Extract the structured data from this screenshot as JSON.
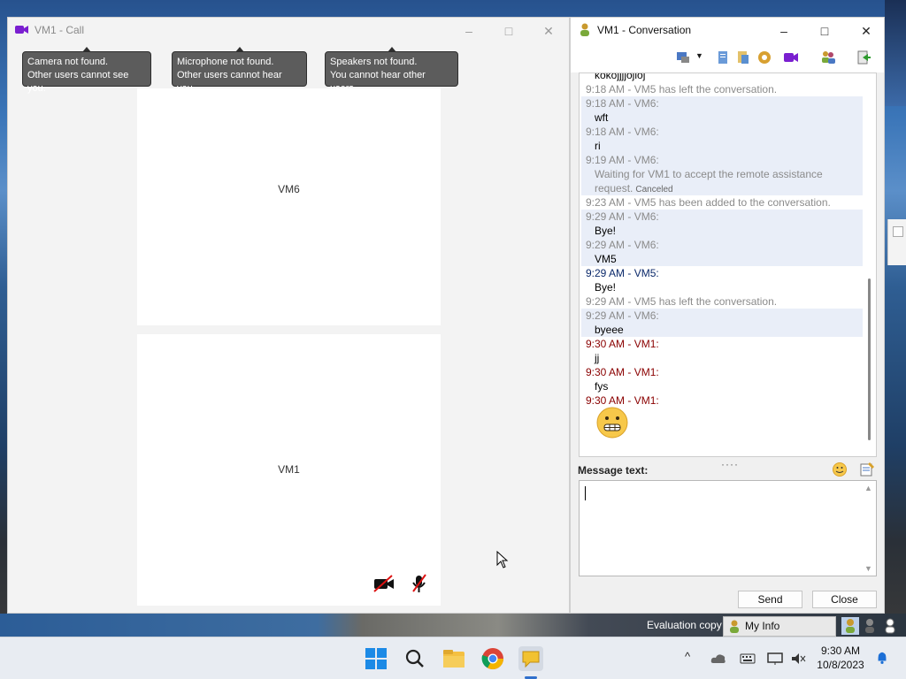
{
  "call_window": {
    "title": "VM1 - Call",
    "tooltips": {
      "camera_line1": "Camera not found.",
      "camera_line2": "Other users cannot see you.",
      "mic_line1": "Microphone not found.",
      "mic_line2": "Other users cannot hear you.",
      "speaker_line1": "Speakers not found.",
      "speaker_line2": "You cannot hear other users."
    },
    "remote_tile_label": "VM6",
    "local_tile_label": "VM1"
  },
  "conversation": {
    "title": "VM1 - Conversation",
    "messages": [
      {
        "kind": "body",
        "text": "kokojjjjojioj"
      },
      {
        "kind": "sys",
        "text": "9:18 AM - VM5 has left the conversation."
      },
      {
        "kind": "sender",
        "text": "9:18 AM - VM6:"
      },
      {
        "kind": "body",
        "text": "wft"
      },
      {
        "kind": "sender",
        "text": "9:18 AM - VM6:"
      },
      {
        "kind": "body",
        "text": "ri"
      },
      {
        "kind": "sender",
        "text": "9:19 AM - VM6:"
      },
      {
        "kind": "muted",
        "text": "Waiting for VM1 to accept the remote assistance"
      },
      {
        "kind": "muted",
        "text": "request."
      },
      {
        "kind": "sys",
        "text": "9:23 AM - VM5 has been added to the conversation."
      },
      {
        "kind": "sender",
        "text": "9:29 AM - VM6:"
      },
      {
        "kind": "body",
        "text": "Bye!"
      },
      {
        "kind": "sender",
        "text": "9:29 AM - VM6:"
      },
      {
        "kind": "body",
        "text": "VM5"
      },
      {
        "kind": "vm5",
        "text": "9:29 AM - VM5:"
      },
      {
        "kind": "body",
        "text": "Bye!"
      },
      {
        "kind": "sys",
        "text": "9:29 AM - VM5 has left the conversation."
      },
      {
        "kind": "sender",
        "text": "9:29 AM - VM6:"
      },
      {
        "kind": "body",
        "text": "byeee"
      },
      {
        "kind": "me",
        "text": "9:30 AM - VM1:"
      },
      {
        "kind": "body",
        "text": "jj"
      },
      {
        "kind": "me",
        "text": "9:30 AM - VM1:"
      },
      {
        "kind": "body",
        "text": "fys"
      },
      {
        "kind": "me",
        "text": "9:30 AM - VM1:"
      }
    ],
    "canceled_label": "Canceled",
    "message_label": "Message text:",
    "message_value": "",
    "send_label": "Send",
    "close_label": "Close"
  },
  "desktop": {
    "watermark": "Evaluation copy",
    "myinfo_label": "My Info"
  },
  "taskbar": {
    "time": "9:30 AM",
    "date": "10/8/2023"
  },
  "colors": {
    "accent": "#2f6fcc",
    "own_message": "#8a0000",
    "vm5_message": "#0c2a6b",
    "system_message": "#8b8b8b",
    "highlight_row": "#e9eef8"
  }
}
